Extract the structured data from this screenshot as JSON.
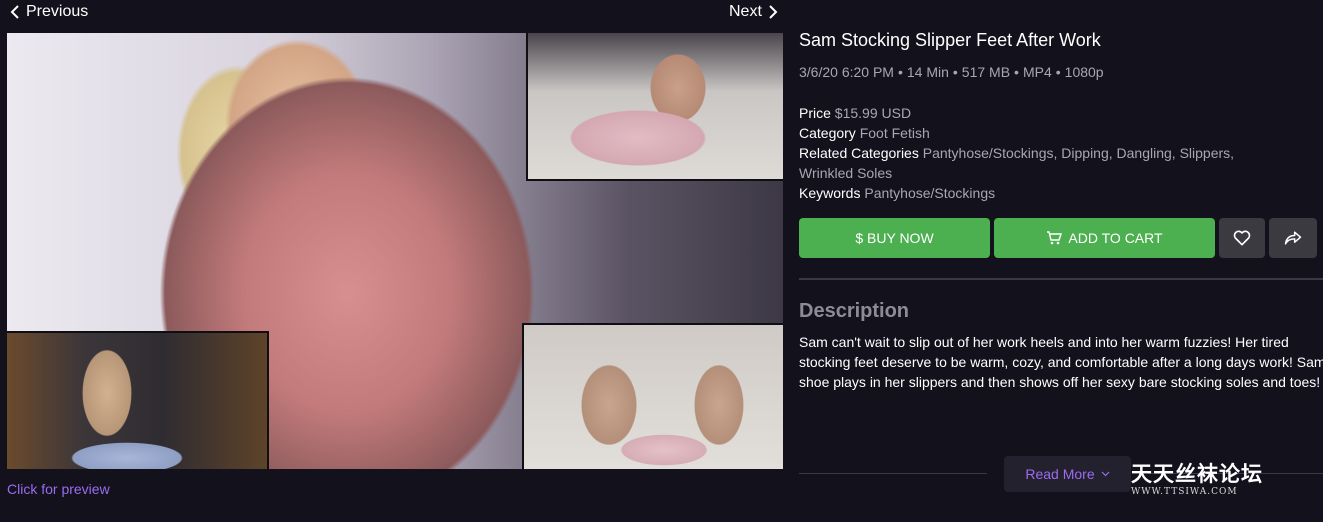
{
  "nav": {
    "previous_label": "Previous",
    "next_label": "Next"
  },
  "preview": {
    "link_label": "Click for preview"
  },
  "product": {
    "title": "Sam Stocking Slipper Feet After Work",
    "meta": {
      "date": "3/6/20 6:20 PM",
      "duration": "14 Min",
      "size": "517 MB",
      "format": "MP4",
      "resolution": "1080p",
      "separator": "•"
    },
    "price_label": "Price",
    "price_value": "$15.99 USD",
    "category_label": "Category",
    "category_value": "Foot Fetish",
    "related_label": "Related Categories",
    "related_value_line1": "Pantyhose/Stockings, Dipping, Dangling, Slippers,",
    "related_value_line2": "Wrinkled Soles",
    "keywords_label": "Keywords",
    "keywords_value": "Pantyhose/Stockings"
  },
  "actions": {
    "buy_now": "$ BUY NOW",
    "add_to_cart": "ADD TO CART",
    "accent_color": "#4caf50",
    "icons": [
      "cart-icon",
      "heart-icon",
      "share-icon"
    ]
  },
  "description": {
    "heading": "Description",
    "line1": "Sam can't wait to slip out of her work heels and into her warm fuzzies! Her tired",
    "line2": "stocking feet deserve to be warm, cozy, and comfortable after a long days work! Sam",
    "line3": "shoe plays in her slippers and then shows off her sexy bare stocking soles and toes!",
    "read_more": "Read More"
  },
  "watermark": {
    "chinese": "天天丝袜论坛",
    "domain": "WWW.TTSIWA.COM"
  },
  "colors": {
    "background": "#13111c",
    "link_purple": "#9b6cf0",
    "muted_text": "#a9a6b3"
  }
}
